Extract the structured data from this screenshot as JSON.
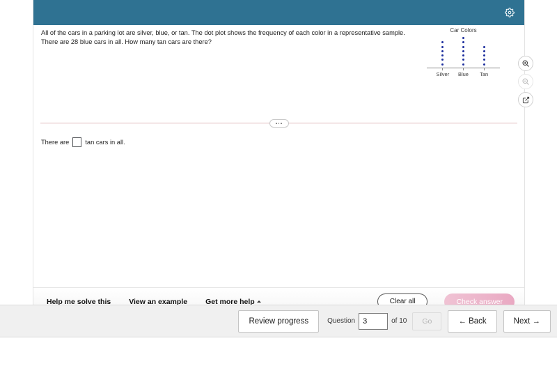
{
  "header": {
    "settings_icon": "gear-icon",
    "bg_color": "#2f7292"
  },
  "problem": {
    "text": "All of the cars in a parking lot are silver, blue, or tan. The dot plot shows the frequency of each color in a representative sample. There are 28 blue cars in all. How many tan cars are there?"
  },
  "tools": [
    {
      "name": "zoom-in-icon",
      "label": "Zoom in",
      "disabled": false
    },
    {
      "name": "zoom-out-icon",
      "label": "Zoom out",
      "disabled": true
    },
    {
      "name": "open-in-new-window-icon",
      "label": "Open in new window",
      "disabled": false
    }
  ],
  "divider": {
    "handle_dots": 3
  },
  "answer": {
    "prefix": "There are",
    "suffix": "tan cars in all.",
    "value": "",
    "placeholder": ""
  },
  "footer": {
    "help_me_solve_this": "Help me solve this",
    "view_an_example": "View an example",
    "get_more_help": "Get more help",
    "clear_all": "Clear all",
    "check_answer": "Check answer",
    "check_answer_color": "#e9a8c2"
  },
  "bottom_nav": {
    "review_progress": "Review progress",
    "question_label": "Question",
    "question_value": "3",
    "of_label": "of 10",
    "go": "Go",
    "back": "← Back",
    "next": "Next →"
  },
  "chart_data": {
    "type": "scatter",
    "title": "Car Colors",
    "xlabel": "",
    "ylabel": "",
    "categories": [
      "Silver",
      "Blue",
      "Tan"
    ],
    "values": [
      6,
      7,
      5
    ],
    "dot_color": "#1d2f9e",
    "axis_color": "#8a8a8a",
    "grid": false,
    "legend": false,
    "note": "Dot plot: each dot represents a frequency unit. Blue column = 7 dots = 28 cars, so 1 dot = 4 cars."
  }
}
